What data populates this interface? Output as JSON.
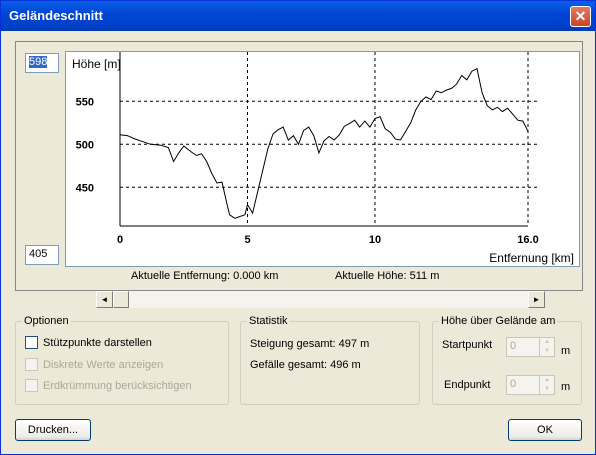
{
  "window": {
    "title": "Geländeschnitt",
    "close_glyph": "✕"
  },
  "profile": {
    "top_value": "598",
    "bottom_value": "405",
    "y_title": "Höhe [m]",
    "x_title": "Entfernung [km]",
    "current_distance": "Aktuelle Entfernung: 0.000 km",
    "current_height": "Aktuelle Höhe: 511 m"
  },
  "chart_data": {
    "type": "line",
    "ylabel": "Höhe [m]",
    "xlabel": "Entfernung [km]",
    "xlim": [
      0,
      16
    ],
    "ylim": [
      405,
      598
    ],
    "x_ticks": [
      "0",
      "5",
      "10",
      "16.0"
    ],
    "y_ticks": [
      "550",
      "500",
      "450"
    ],
    "grid": true,
    "series": [
      {
        "x": [
          0,
          0.3,
          0.6,
          0.9,
          1.2,
          1.6,
          1.9,
          2.1,
          2.3,
          2.5,
          2.8,
          3.0,
          3.2,
          3.4,
          3.6,
          3.8,
          4.0,
          4.2,
          4.3,
          4.5,
          4.7,
          4.9,
          5.0,
          5.2,
          5.4,
          5.6,
          5.8,
          6.0,
          6.2,
          6.4,
          6.6,
          6.8,
          7.0,
          7.2,
          7.4,
          7.6,
          7.8,
          8.0,
          8.2,
          8.4,
          8.6,
          8.8,
          9.0,
          9.2,
          9.4,
          9.6,
          9.8,
          10.0,
          10.2,
          10.4,
          10.6,
          10.8,
          11.0,
          11.2,
          11.4,
          11.6,
          11.8,
          12.0,
          12.2,
          12.4,
          12.6,
          12.8,
          13.0,
          13.2,
          13.4,
          13.6,
          13.8,
          14.0,
          14.2,
          14.4,
          14.6,
          14.8,
          15.0,
          15.2,
          15.4,
          15.6,
          15.8,
          16.0
        ],
        "y": [
          511,
          510,
          506,
          503,
          500,
          499,
          496,
          480,
          490,
          498,
          491,
          487,
          489,
          480,
          466,
          455,
          456,
          430,
          418,
          414,
          416,
          418,
          430,
          420,
          445,
          470,
          495,
          512,
          517,
          520,
          505,
          510,
          500,
          516,
          520,
          510,
          490,
          504,
          509,
          505,
          511,
          521,
          524,
          528,
          520,
          527,
          520,
          530,
          532,
          518,
          514,
          506,
          505,
          515,
          525,
          540,
          550,
          555,
          552,
          562,
          560,
          563,
          565,
          570,
          580,
          575,
          585,
          588,
          560,
          545,
          540,
          543,
          538,
          542,
          535,
          528,
          527,
          515
        ]
      }
    ]
  },
  "scrollbar": {
    "left_arrow": "◄",
    "right_arrow": "►"
  },
  "options": {
    "legend": "Optionen",
    "items": [
      "Stützpunkte darstellen",
      "Diskrete Werte anzeigen",
      "Erdkrümmung berücksichtigen"
    ]
  },
  "statistics": {
    "legend": "Statistik",
    "ascent": "Steigung gesamt: 497 m",
    "descent": "Gefälle gesamt: 496 m"
  },
  "height_above": {
    "legend": "Höhe über Gelände am",
    "start_label": "Startpunkt",
    "start_value": "0",
    "start_unit": "m",
    "end_label": "Endpunkt",
    "end_value": "0",
    "end_unit": "m"
  },
  "buttons": {
    "print": "Drucken...",
    "ok": "OK"
  }
}
